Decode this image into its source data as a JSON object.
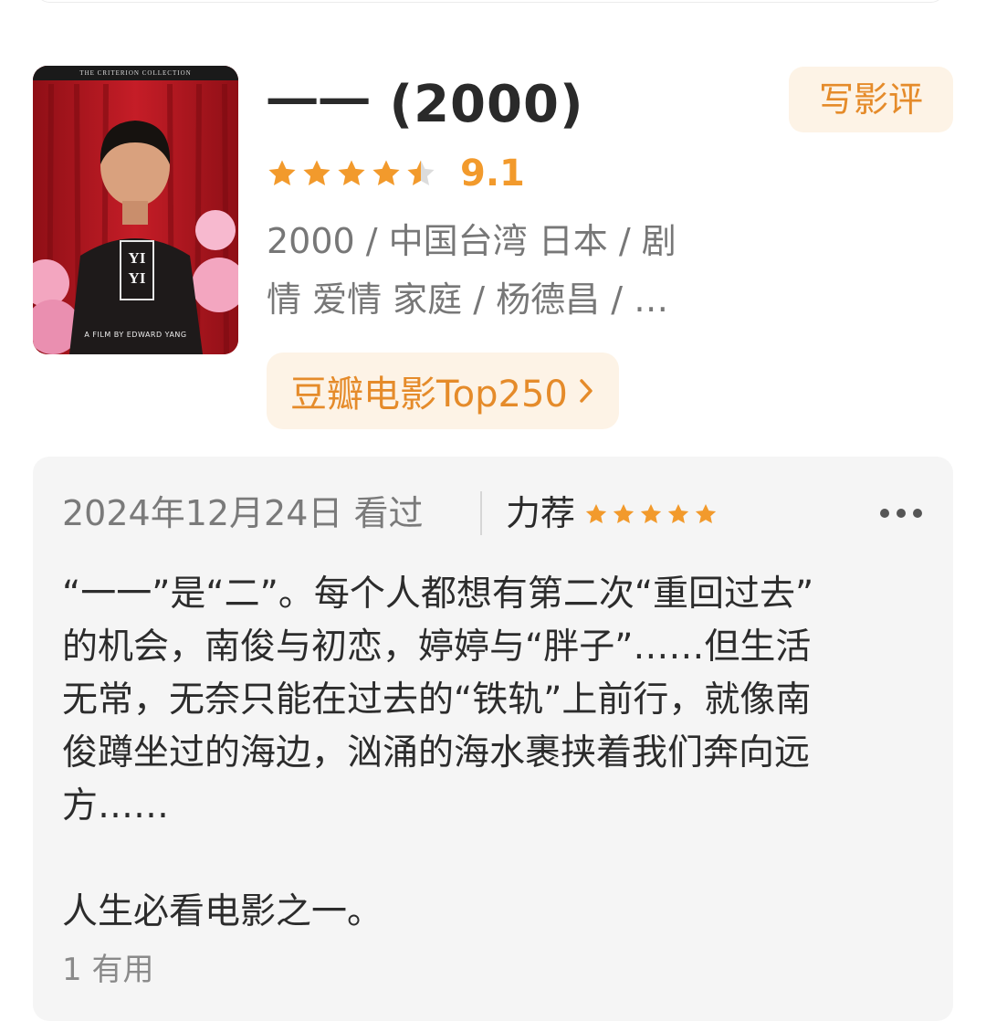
{
  "movie": {
    "title": "一一 (2000)",
    "rating_stars": 4.5,
    "rating_score": "9.1",
    "meta_lines": [
      "2000 / 中国台湾 日本 / 剧",
      "情 爱情 家庭 / 杨德昌 / …"
    ],
    "top250_label": "豆瓣电影Top250",
    "write_review_label": "写影评",
    "poster": {
      "collection_text": "THE CRITERION COLLECTION",
      "title_text": "YI YI",
      "credit_text": "A FILM BY EDWARD YANG"
    }
  },
  "review": {
    "date_status": "2024年12月24日 看过",
    "verdict": "力荐",
    "stars": 5,
    "lines": [
      "“一一”是“二”。每个人都想有第二次“重回过去”",
      "的机会，南俊与初恋，婷婷与“胖子”……但生活",
      "无常，无奈只能在过去的“铁轨”上前行，就像南",
      "俊蹲坐过的海边，汹涌的海水裹挟着我们奔向远",
      "方……"
    ],
    "closing_line": "人生必看电影之一。",
    "useful_label": "1 有用"
  },
  "colors": {
    "accent_orange": "#f29a2c",
    "button_bg": "#fdf3e6",
    "card_bg": "#f5f5f5"
  }
}
